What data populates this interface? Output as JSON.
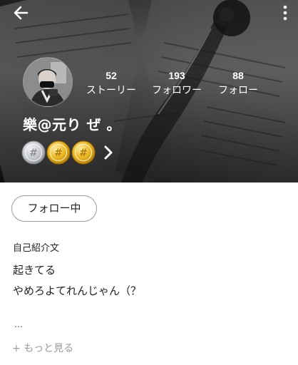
{
  "colors": {
    "header_bg": "#3a3a3a",
    "text_on_header": "#ffffff",
    "body_text": "#222222",
    "muted_text": "#9a9a9a",
    "silver_badge": "#c9ccd1",
    "gold_badge": "#e0aa1c"
  },
  "toolbar": {
    "back_icon": "arrow-left-icon",
    "more_icon": "more-vertical-icon"
  },
  "profile": {
    "username": "樂@元り ぜ 。",
    "stats": [
      {
        "value": "52",
        "label": "ストーリー"
      },
      {
        "value": "193",
        "label": "フォロワー"
      },
      {
        "value": "88",
        "label": "フォロー"
      }
    ],
    "badges": [
      {
        "kind": "silver",
        "icon": "silver-badge-icon"
      },
      {
        "kind": "gold",
        "icon": "gold-badge-icon"
      },
      {
        "kind": "gold",
        "icon": "gold-badge-icon"
      }
    ],
    "badges_arrow_icon": "chevron-right-icon"
  },
  "actions": {
    "follow_label": "フォロー中"
  },
  "bio": {
    "title": "自己紹介文",
    "lines": [
      "起きてる",
      "やめろよてれんじゃん（？"
    ],
    "ellipsis": "…",
    "more_label": "+ もっと見る"
  }
}
